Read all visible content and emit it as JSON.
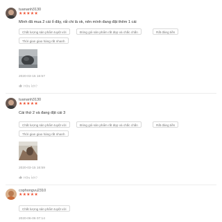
{
  "reviews": [
    {
      "username": "tuananh3130",
      "stars": "★★★★★",
      "comment": "Mình đã mua 2 cái ổ đây, rất chi là ok, nên mình đang đặt thêm 1 cái",
      "tags": [
        "Chất lượng sản phẩm tuyệt vời",
        "Đóng gói sản phẩm rất đẹp và chắc chắn",
        "Rất đáng tiền",
        "Thời gian giao hàng rất nhanh"
      ],
      "timestamp": "2020-03-15 16:57",
      "like_label": "Hữu Ích?"
    },
    {
      "username": "tuananh3130",
      "stars": "★★★★★",
      "comment": "Cái thứ 2 và đang đặt cái 3",
      "tags": [
        "Chất lượng sản phẩm tuyệt vời",
        "Đóng gói sản phẩm rất đẹp và chắc chắn",
        "Rất đáng tiền",
        "Thời gian giao hàng rất nhanh"
      ],
      "timestamp": "2020-03-15 16:59",
      "like_label": "Hữu Ích?"
    },
    {
      "username": "cophongvu2310",
      "stars": "★★★★★",
      "tags": [
        "Chất lượng sản phẩm tuyệt vời"
      ],
      "timestamp": "2020-06-06 07:14"
    }
  ]
}
